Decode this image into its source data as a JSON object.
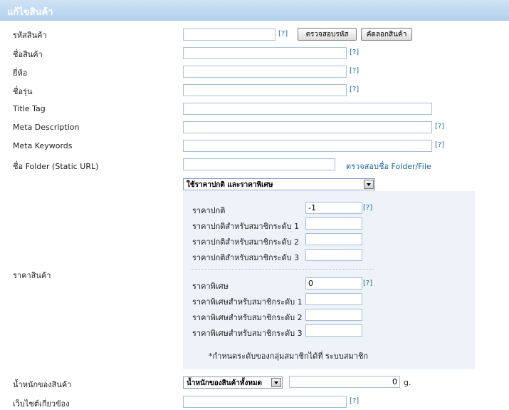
{
  "header": {
    "title": "แก้ไขสินค้า"
  },
  "help_text": "[?]",
  "fields": {
    "product_code": {
      "label": "รหัสสินค้า",
      "value": ""
    },
    "check_code_button": "ตรวจสอบรหัส",
    "copy_product_button": "คัดลอกสินค้า",
    "product_name": {
      "label": "ชื่อสินค้า",
      "value": ""
    },
    "brand": {
      "label": "ยี่ห้อ",
      "value": ""
    },
    "model": {
      "label": "ชื่อรุ่น",
      "value": ""
    },
    "title_tag": {
      "label": "Title Tag",
      "value": ""
    },
    "meta_description": {
      "label": "Meta Description",
      "value": ""
    },
    "meta_keywords": {
      "label": "Meta Keywords",
      "value": ""
    },
    "folder": {
      "label": "ชื่อ Folder (Static URL)",
      "value": "",
      "check_link": "ตรวจสอบชื่อ Folder/File"
    }
  },
  "price": {
    "label": "ราคาสินค้า",
    "mode_selected": "ใช้ราคาปกติ และราคาพิเศษ",
    "normal": {
      "label": "ราคาปกติ",
      "value": "-1"
    },
    "normal_tiers": [
      {
        "label": "ราคาปกติสำหรับสมาชิกระดับ 1",
        "value": ""
      },
      {
        "label": "ราคาปกติสำหรับสมาชิกระดับ 2",
        "value": ""
      },
      {
        "label": "ราคาปกติสำหรับสมาชิกระดับ 3",
        "value": ""
      }
    ],
    "special": {
      "label": "ราคาพิเศษ",
      "value": "0"
    },
    "special_tiers": [
      {
        "label": "ราคาพิเศษสำหรับสมาชิกระดับ 1",
        "value": ""
      },
      {
        "label": "ราคาพิเศษสำหรับสมาชิกระดับ 2",
        "value": ""
      },
      {
        "label": "ราคาพิเศษสำหรับสมาชิกระดับ 3",
        "value": ""
      }
    ],
    "note": "*กำหนดระดับของกลุ่มสมาชิกได้ที่ ระบบสมาชิก"
  },
  "weight": {
    "label": "น้ำหนักของสินค้า",
    "mode_selected": "น้ำหนักของสินค้าทั้งหมด",
    "value": "0",
    "unit": "g."
  },
  "related_site": {
    "label": "เว็บไซต์เกี่ยวข้อง",
    "value": ""
  }
}
